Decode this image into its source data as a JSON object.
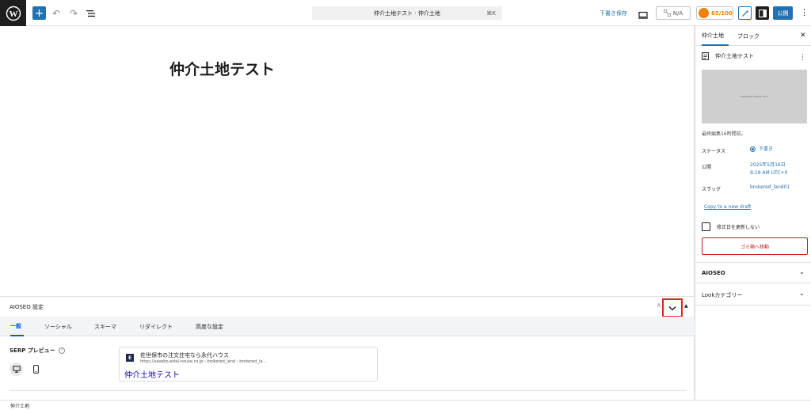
{
  "toolbar": {
    "add_label": "+",
    "undo_label": "↶",
    "redo_label": "↷",
    "document_title": "仲介土地テスト · 仲介土地",
    "shortcut": "⌘K",
    "save_draft": "下書き保存",
    "na_label": "N/A",
    "seo_score": "65/100",
    "publish": "公開",
    "more": "⋮"
  },
  "editor": {
    "post_title": "仲介土地テスト"
  },
  "aioseo_panel": {
    "title": "AIOSEO 設定",
    "tabs": [
      {
        "label": "一般"
      },
      {
        "label": "ソーシャル"
      },
      {
        "label": "スキーマ"
      },
      {
        "label": "リダイレクト"
      },
      {
        "label": "高度な設定"
      }
    ],
    "serp_label": "SERP プレビュー",
    "serp": {
      "favicon_letter": "E",
      "site_name": "佐世保市の注文住宅なら永代ハウス",
      "url": "https://sasebo.eidai-house.co.jp › brokered_land › brokered_la...",
      "title": "仲介土地テスト"
    }
  },
  "footer": {
    "breadcrumb": "仲介土地"
  },
  "sidebar": {
    "tabs": [
      {
        "label": "仲介土地"
      },
      {
        "label": "ブロック"
      }
    ],
    "close": "✕",
    "post_name": "仲介土地テスト",
    "more": "⋮",
    "featured_image_text": "FEATURED IMAGE TEXT",
    "last_edited": "最終編集16時間前。",
    "rows": {
      "status_label": "ステータス",
      "status_value": "下書き",
      "publish_label": "公開",
      "publish_date": "2025年5月16日",
      "publish_time": "9:19 AM UTC+0",
      "slug_label": "スラッグ",
      "slug_value": "brokered_land01"
    },
    "copy_draft": "Copy to a new draft",
    "no_update_modified": "修正日を更新しない",
    "trash": "ゴミ箱へ移動",
    "panels": [
      {
        "label": "AIOSEO"
      },
      {
        "label": "Lookカテゴリー"
      }
    ]
  },
  "colors": {
    "accent": "#2271b1",
    "seo_score": "#f18200",
    "trash": "#cc1818",
    "highlight_box": "#e0251c",
    "serp_title": "#1a0dab"
  }
}
